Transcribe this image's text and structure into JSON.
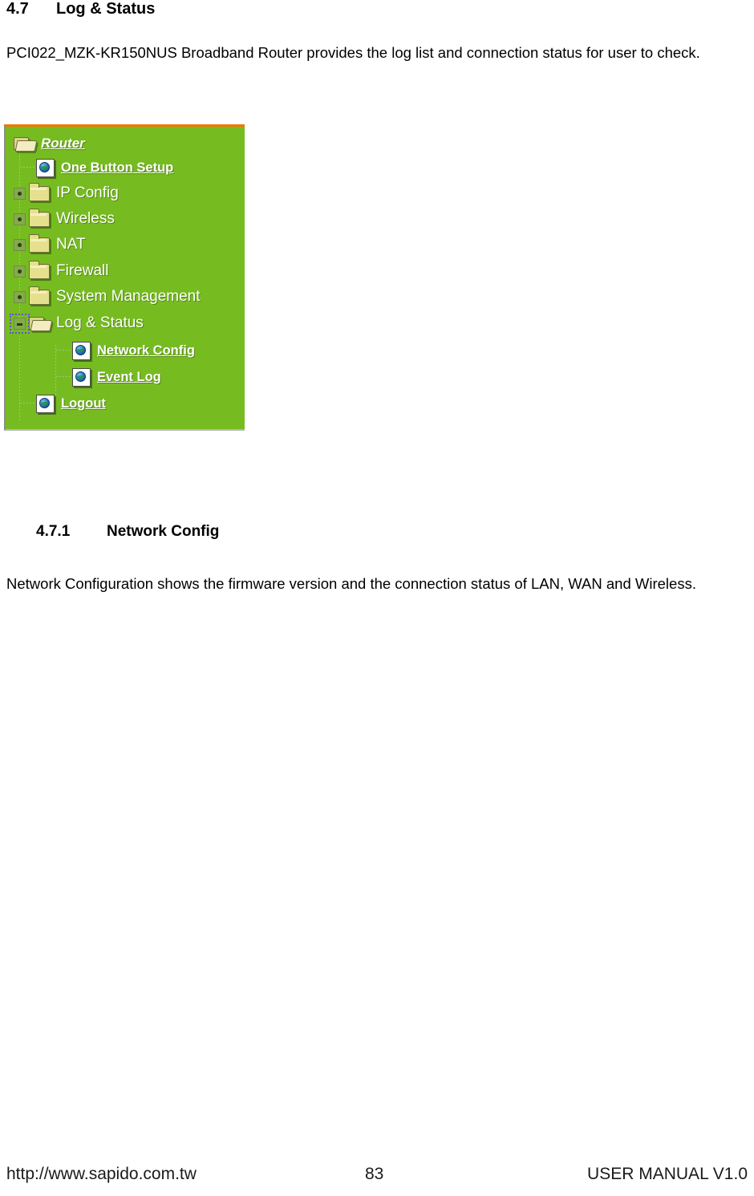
{
  "section": {
    "number": "4.7",
    "title": "Log & Status",
    "intro": "PCI022_MZK-KR150NUS Broadband Router provides the log list and connection status for user to check."
  },
  "subsection": {
    "number": "4.7.1",
    "title": "Network Config",
    "body_line1": "Network Configuration shows the firmware version and the connection status of LAN, WAN",
    "body_line2": "and Wireless."
  },
  "menu": {
    "accent_top_color": "#f07800",
    "background_color": "#76bc21",
    "text_color": "#ffffff",
    "items": [
      {
        "label": "Router",
        "icon": "folder-open-icon",
        "toggle": "none"
      },
      {
        "label": "One Button Setup",
        "icon": "page-globe-icon",
        "toggle": "none"
      },
      {
        "label": "IP Config",
        "icon": "folder-closed-icon",
        "toggle": "plus"
      },
      {
        "label": "Wireless",
        "icon": "folder-closed-icon",
        "toggle": "plus"
      },
      {
        "label": "NAT",
        "icon": "folder-closed-icon",
        "toggle": "plus"
      },
      {
        "label": "Firewall",
        "icon": "folder-closed-icon",
        "toggle": "plus"
      },
      {
        "label": "System Management",
        "icon": "folder-closed-icon",
        "toggle": "plus"
      },
      {
        "label": "Log & Status",
        "icon": "folder-open-icon",
        "toggle": "minus"
      },
      {
        "label": "Network Config",
        "icon": "page-globe-icon",
        "toggle": "none"
      },
      {
        "label": "Event Log",
        "icon": "page-globe-icon",
        "toggle": "none"
      },
      {
        "label": "Logout",
        "icon": "page-globe-icon",
        "toggle": "none"
      }
    ]
  },
  "footer": {
    "url": "http://www.sapido.com.tw",
    "page_number": "83",
    "manual": "USER MANUAL V1.0"
  }
}
